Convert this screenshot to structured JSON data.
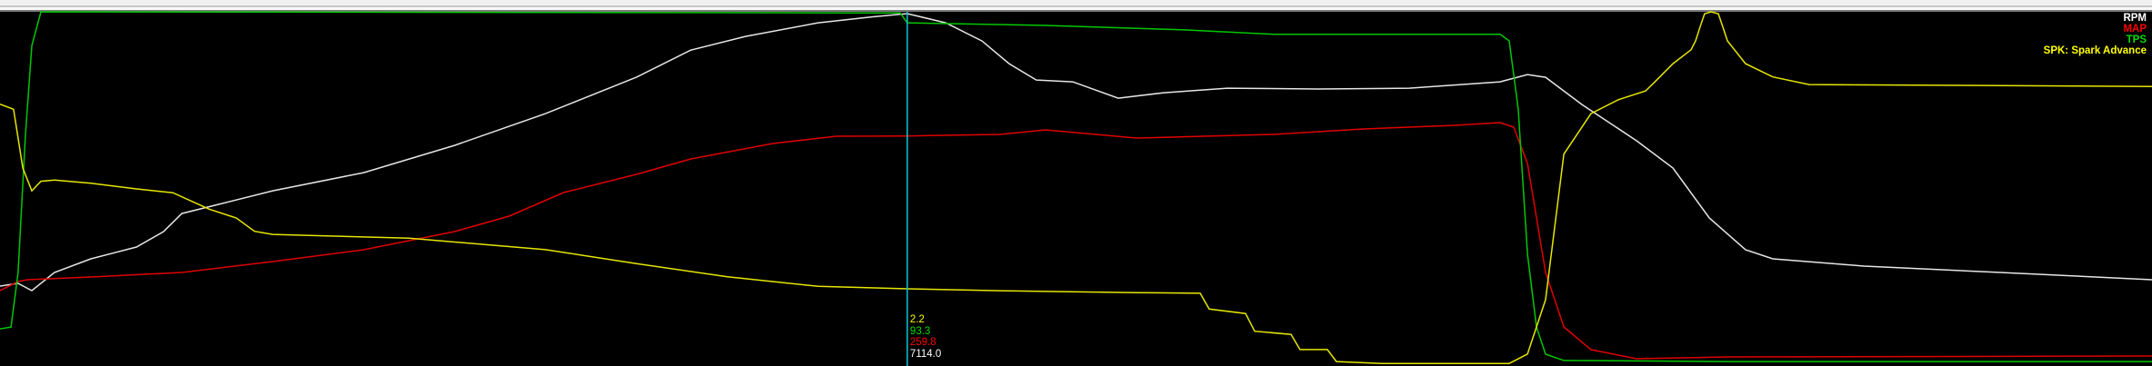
{
  "chart_data": {
    "type": "line",
    "title": "",
    "xlabel": "",
    "ylabel": "",
    "xlim": [
      0,
      100
    ],
    "grid": false,
    "legend_placement": "top-right",
    "cursor": {
      "x": 42.16,
      "color": "#00c8d8"
    },
    "series": [
      {
        "name": "RPM",
        "label": "RPM",
        "color": "#e6e6e6",
        "ylim": [
          0,
          7150
        ],
        "cursor_value": "7114.0",
        "points": [
          [
            0,
            1613
          ],
          [
            0.84,
            1668
          ],
          [
            1.48,
            1521
          ],
          [
            2.53,
            1888
          ],
          [
            4.22,
            2163
          ],
          [
            6.34,
            2401
          ],
          [
            7.6,
            2713
          ],
          [
            8.45,
            3079
          ],
          [
            10.14,
            3262
          ],
          [
            12.67,
            3537
          ],
          [
            16.9,
            3904
          ],
          [
            21.12,
            4454
          ],
          [
            25.35,
            5095
          ],
          [
            29.57,
            5829
          ],
          [
            32.11,
            6379
          ],
          [
            34.64,
            6654
          ],
          [
            38.02,
            6929
          ],
          [
            40.56,
            7050
          ],
          [
            42.16,
            7114
          ],
          [
            43.94,
            6929
          ],
          [
            45.63,
            6562
          ],
          [
            46.89,
            6104
          ],
          [
            48.16,
            5774
          ],
          [
            49.85,
            5737
          ],
          [
            51.96,
            5407
          ],
          [
            54.08,
            5517
          ],
          [
            57.03,
            5609
          ],
          [
            61.26,
            5591
          ],
          [
            65.48,
            5609
          ],
          [
            69.71,
            5737
          ],
          [
            70.98,
            5884
          ],
          [
            71.82,
            5829
          ],
          [
            73.51,
            5279
          ],
          [
            76.05,
            4546
          ],
          [
            77.74,
            3996
          ],
          [
            79.43,
            2988
          ],
          [
            81.11,
            2346
          ],
          [
            82.38,
            2163
          ],
          [
            86.61,
            2016
          ],
          [
            92.94,
            1888
          ],
          [
            100,
            1741
          ]
        ]
      },
      {
        "name": "MAP",
        "label": "MAP",
        "color": "#e00000",
        "ylim": [
          0,
          400
        ],
        "cursor_value": "259.8",
        "points": [
          [
            0,
            85.1
          ],
          [
            0.84,
            95.4
          ],
          [
            1.27,
            97.4
          ],
          [
            4.22,
            100.5
          ],
          [
            8.45,
            105.6
          ],
          [
            12.67,
            117.9
          ],
          [
            16.9,
            131.3
          ],
          [
            21.12,
            151.8
          ],
          [
            23.66,
            169.2
          ],
          [
            26.19,
            195.9
          ],
          [
            29.57,
            216.4
          ],
          [
            32.11,
            233.8
          ],
          [
            35.91,
            251.3
          ],
          [
            38.87,
            259.5
          ],
          [
            42.16,
            259.8
          ],
          [
            46.47,
            261.5
          ],
          [
            48.58,
            266.7
          ],
          [
            52.81,
            257.4
          ],
          [
            59.15,
            261.5
          ],
          [
            63.37,
            267.7
          ],
          [
            67.6,
            271.8
          ],
          [
            69.71,
            274.9
          ],
          [
            70.34,
            269.7
          ],
          [
            70.98,
            228.7
          ],
          [
            71.82,
            105.6
          ],
          [
            72.67,
            44.1
          ],
          [
            73.93,
            18.5
          ],
          [
            76.05,
            8.2
          ],
          [
            80.27,
            10.3
          ],
          [
            100,
            11.3
          ]
        ]
      },
      {
        "name": "TPS",
        "label": "TPS",
        "color": "#00c800",
        "ylim": [
          0,
          96.3
        ],
        "cursor_value": "93.3",
        "points": [
          [
            0,
            10.1
          ],
          [
            0.51,
            10.6
          ],
          [
            0.84,
            25.4
          ],
          [
            1.18,
            62.5
          ],
          [
            1.48,
            87.1
          ],
          [
            1.9,
            96.3
          ],
          [
            41.83,
            96.0
          ],
          [
            42.16,
            93.3
          ],
          [
            48.58,
            92.6
          ],
          [
            54.92,
            91.4
          ],
          [
            59.15,
            90.2
          ],
          [
            69.71,
            90.2
          ],
          [
            70.13,
            88.4
          ],
          [
            70.55,
            69.9
          ],
          [
            70.98,
            30.4
          ],
          [
            71.4,
            10.6
          ],
          [
            71.82,
            3.2
          ],
          [
            72.67,
            1.5
          ],
          [
            80.27,
            1.2
          ],
          [
            100,
            1.2
          ]
        ]
      },
      {
        "name": "SPK",
        "label": "SPK: Spark Advance",
        "color": "#e6e600",
        "ylim": [
          -10,
          46
        ],
        "cursor_value": "2.2",
        "points": [
          [
            0,
            31.4
          ],
          [
            0.63,
            30.6
          ],
          [
            1.06,
            21.3
          ],
          [
            1.48,
            17.7
          ],
          [
            1.9,
            19.2
          ],
          [
            2.53,
            19.4
          ],
          [
            4.22,
            18.9
          ],
          [
            6.34,
            18.0
          ],
          [
            8.03,
            17.4
          ],
          [
            9.72,
            14.8
          ],
          [
            10.98,
            13.4
          ],
          [
            11.83,
            11.3
          ],
          [
            12.67,
            10.8
          ],
          [
            19.01,
            10.2
          ],
          [
            25.35,
            8.4
          ],
          [
            29.57,
            6.2
          ],
          [
            33.8,
            4.1
          ],
          [
            38.02,
            2.6
          ],
          [
            42.16,
            2.2
          ],
          [
            46.47,
            1.9
          ],
          [
            52.81,
            1.6
          ],
          [
            55.77,
            1.5
          ],
          [
            56.19,
            -1.0
          ],
          [
            57.88,
            -1.7
          ],
          [
            58.3,
            -4.5
          ],
          [
            59.99,
            -5.0
          ],
          [
            60.41,
            -7.4
          ],
          [
            61.68,
            -7.4
          ],
          [
            62.1,
            -9.3
          ],
          [
            64.22,
            -9.6
          ],
          [
            70.13,
            -9.6
          ],
          [
            70.98,
            -8.1
          ],
          [
            71.82,
            0.5
          ],
          [
            72.67,
            23.5
          ],
          [
            73.93,
            29.9
          ],
          [
            75.2,
            32.1
          ],
          [
            76.47,
            33.5
          ],
          [
            76.89,
            34.9
          ],
          [
            77.74,
            37.8
          ],
          [
            78.58,
            40.0
          ],
          [
            78.79,
            41.4
          ],
          [
            79.0,
            43.6
          ],
          [
            79.21,
            45.7
          ],
          [
            79.51,
            46.0
          ],
          [
            79.85,
            45.7
          ],
          [
            80.06,
            43.6
          ],
          [
            80.27,
            41.4
          ],
          [
            81.11,
            37.8
          ],
          [
            82.38,
            35.7
          ],
          [
            84.07,
            34.5
          ],
          [
            100,
            34.2
          ]
        ]
      }
    ]
  }
}
